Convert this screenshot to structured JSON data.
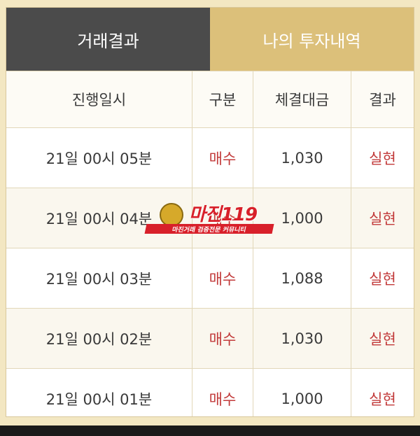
{
  "tabs": [
    {
      "label": "거래결과",
      "active": true
    },
    {
      "label": "나의 투자내역",
      "active": false
    }
  ],
  "table": {
    "headers": [
      "진행일시",
      "구분",
      "체결대금",
      "결과"
    ],
    "rows": [
      {
        "time": "21일 00시 05분",
        "type": "매수",
        "amount": "1,030",
        "result": "실현"
      },
      {
        "time": "21일 00시 04분",
        "type": "매수",
        "amount": "1,000",
        "result": "실현"
      },
      {
        "time": "21일 00시 03분",
        "type": "매수",
        "amount": "1,088",
        "result": "실현"
      },
      {
        "time": "21일 00시 02분",
        "type": "매수",
        "amount": "1,030",
        "result": "실현"
      },
      {
        "time": "21일 00시 01분",
        "type": "매수",
        "amount": "1,000",
        "result": "실현"
      }
    ]
  },
  "watermark": {
    "title": "마진119",
    "subtitle": "마진거래 검증전문 커뮤니티"
  },
  "colors": {
    "active_tab": "#4b4b4b",
    "inactive_tab": "#dcc07a",
    "accent_red": "#c23a3a"
  }
}
